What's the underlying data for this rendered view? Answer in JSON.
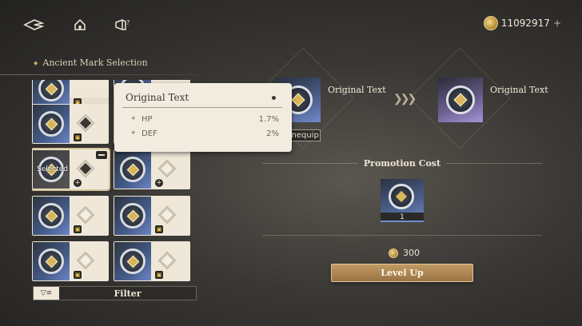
{
  "currency": {
    "amount": "11092917",
    "plus": "+"
  },
  "panel": {
    "title": "Ancient Mark Selection"
  },
  "grid": {
    "selected_label": "Selected"
  },
  "filter": {
    "label": "Filter"
  },
  "tooltip": {
    "title": "Original Text",
    "stats": [
      {
        "name": "HP",
        "value": "1.7%"
      },
      {
        "name": "DEF",
        "value": "2%"
      }
    ]
  },
  "equip": {
    "current_name": "Original Text",
    "next_name": "Original Text",
    "unequip_label": "Unequip"
  },
  "promotion": {
    "title": "Promotion Cost",
    "item_qty": "1",
    "gold_cost": "300",
    "level_up_label": "Level Up"
  }
}
